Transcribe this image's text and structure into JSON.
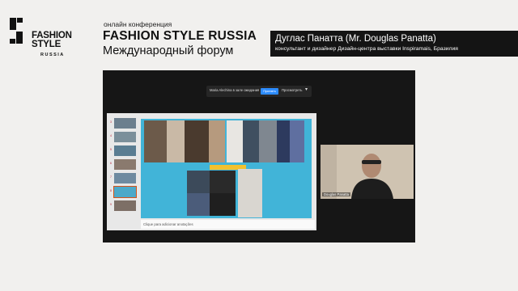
{
  "brand": {
    "line1": "FASHION",
    "line2": "STYLE",
    "sub": "RUSSIA"
  },
  "conference": {
    "label": "онлайн конференция",
    "title": "FASHION STYLE RUSSIA",
    "subtitle": "Международный форум"
  },
  "speaker": {
    "name": "Дуглас Панатта (Mr. Douglas Panatta)",
    "role": "консультант и дизайнер Дизайн-центра выставки Inspiramais, Бразилия"
  },
  "zoom": {
    "waiting_text": "Maria Alechina в зале ожидания",
    "accept_label": "Принять",
    "preview_label": "Просмотреть",
    "more_label": "▾",
    "notes_placeholder": "Clique para adicionar anotações",
    "participant_name": "Douglas Panatta",
    "thumb_numbers": [
      "3",
      "4",
      "5",
      "6",
      "7",
      "8",
      "9"
    ]
  },
  "colors": {
    "accent": "#2d8cff",
    "slide_bg": "#41b4d8",
    "highlight": "#f2c12e"
  }
}
